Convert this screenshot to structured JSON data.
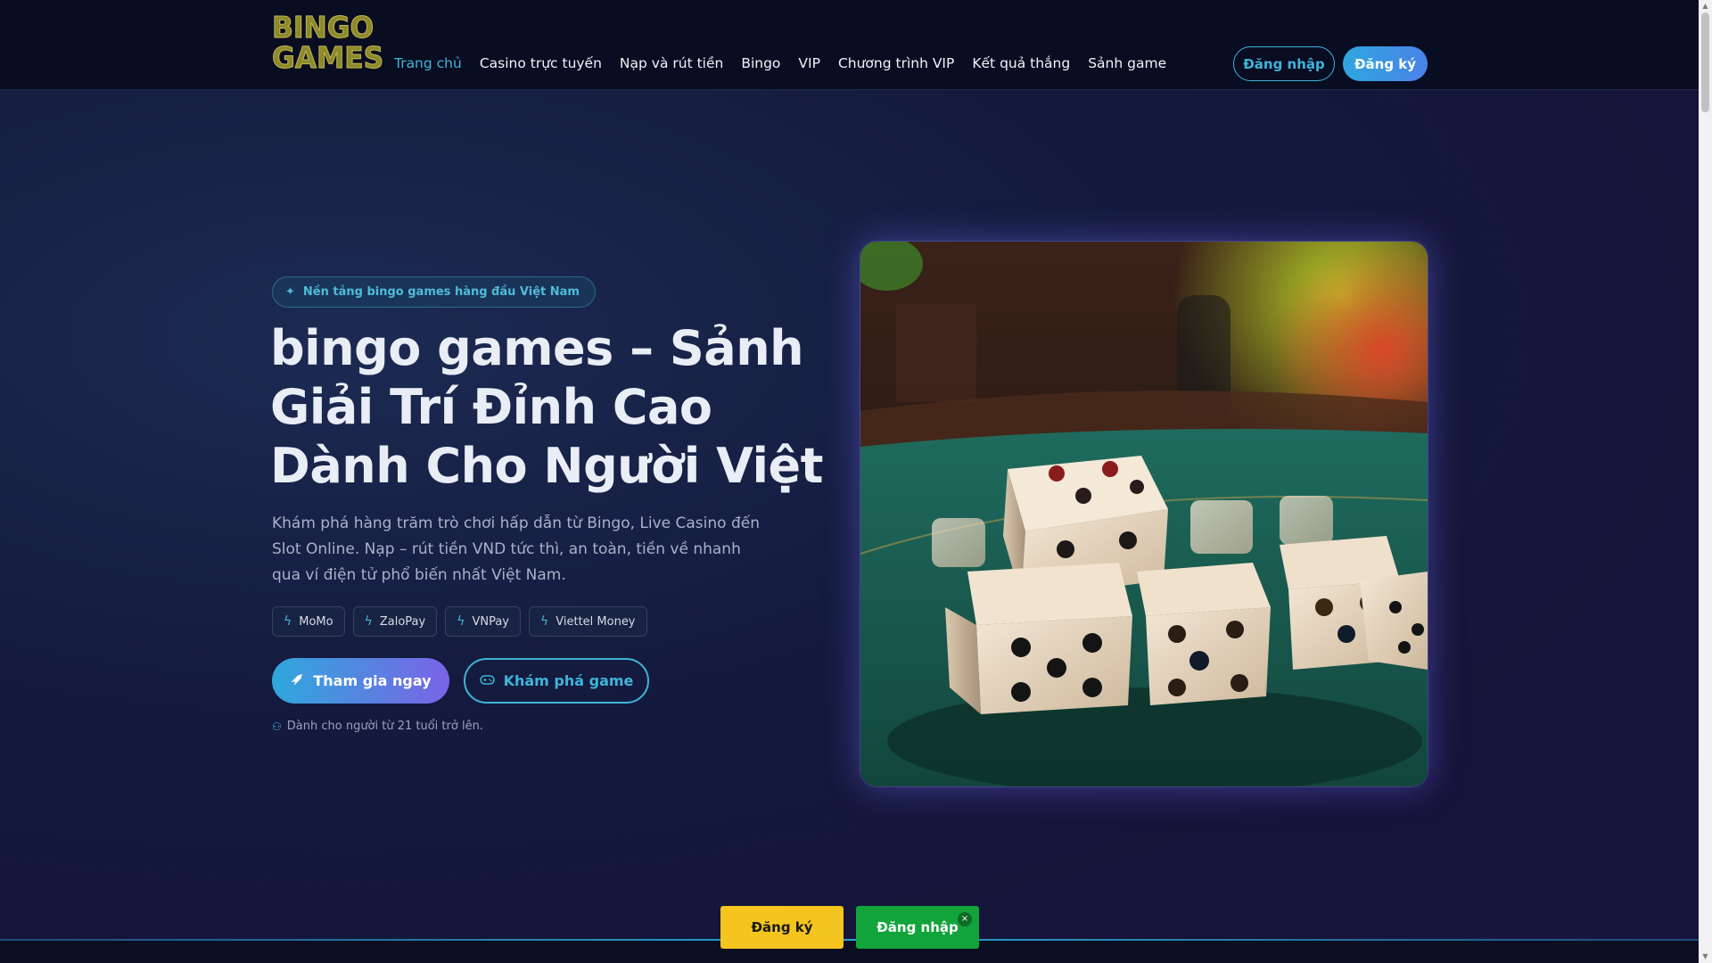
{
  "header": {
    "logo_text": "BINGO GAMES",
    "nav": [
      {
        "label": "Trang chủ",
        "active": true
      },
      {
        "label": "Casino trực tuyến"
      },
      {
        "label": "Nạp và rút tiền"
      },
      {
        "label": "Bingo"
      },
      {
        "label": "VIP"
      },
      {
        "label": "Chương trình VIP"
      },
      {
        "label": "Kết quả thắng"
      },
      {
        "label": "Sảnh game"
      }
    ],
    "login_label": "Đăng nhập",
    "register_label": "Đăng ký"
  },
  "hero": {
    "badge": "Nền tảng bingo games hàng đầu Việt Nam",
    "title": "bingo games – Sảnh Giải Trí Đỉnh Cao Dành Cho Người Việt",
    "description": "Khám phá hàng trăm trò chơi hấp dẫn từ Bingo, Live Casino đến Slot Online. Nạp – rút tiền VND tức thì, an toàn, tiền về nhanh qua ví điện tử phổ biến nhất Việt Nam.",
    "payments": [
      "MoMo",
      "ZaloPay",
      "VNPay",
      "Viettel Money"
    ],
    "join_label": "Tham gia ngay",
    "explore_label": "Khám phá game",
    "age_note": "Dành cho người từ 21 tuổi trở lên."
  },
  "floating": {
    "register_label": "Đăng ký",
    "login_label": "Đăng nhập",
    "close_symbol": "×"
  },
  "colors": {
    "accent": "#3fb4d9",
    "header_bg": "#080d22",
    "register_float": "#f4c41f",
    "login_float": "#12a43a"
  }
}
